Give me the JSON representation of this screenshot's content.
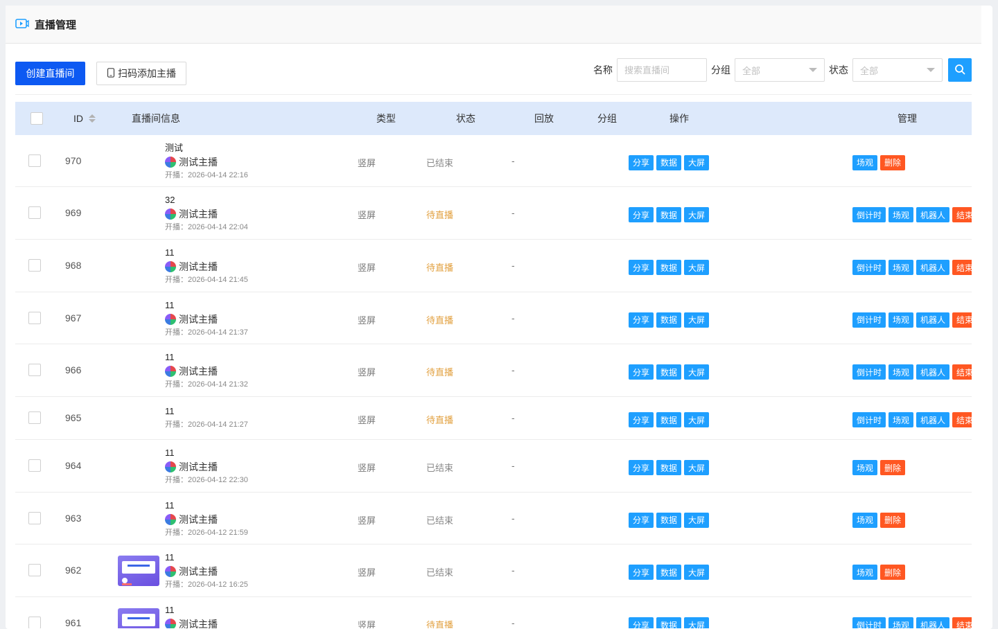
{
  "page": {
    "title": "直播管理"
  },
  "toolbar": {
    "create_label": "创建直播间",
    "scan_label": "扫码添加主播"
  },
  "filters": {
    "name_label": "名称",
    "name_placeholder": "搜索直播间",
    "group_label": "分组",
    "group_value": "全部",
    "status_label": "状态",
    "status_value": "全部"
  },
  "table": {
    "headers": {
      "id": "ID",
      "info": "直播间信息",
      "type": "类型",
      "status": "状态",
      "replay": "回放",
      "group": "分组",
      "ops": "操作",
      "manage": "管理"
    },
    "rows": [
      {
        "id": "970",
        "name": "测试",
        "anchor": "测试主播",
        "time": "开播：2026-04-14 22:16",
        "type": "竖屏",
        "status": "已结束",
        "replay": "-",
        "ops": [
          "分享",
          "数据",
          "大屏"
        ],
        "manage": [
          "场观",
          "删除"
        ]
      },
      {
        "id": "969",
        "name": "32",
        "anchor": "测试主播",
        "time": "开播：2026-04-14 22:04",
        "type": "竖屏",
        "status": "待直播",
        "replay": "-",
        "ops": [
          "分享",
          "数据",
          "大屏"
        ],
        "manage": [
          "倒计时",
          "场观",
          "机器人",
          "结束"
        ]
      },
      {
        "id": "968",
        "name": "11",
        "anchor": "测试主播",
        "time": "开播：2026-04-14 21:45",
        "type": "竖屏",
        "status": "待直播",
        "replay": "-",
        "ops": [
          "分享",
          "数据",
          "大屏"
        ],
        "manage": [
          "倒计时",
          "场观",
          "机器人",
          "结束"
        ]
      },
      {
        "id": "967",
        "name": "11",
        "anchor": "测试主播",
        "time": "开播：2026-04-14 21:37",
        "type": "竖屏",
        "status": "待直播",
        "replay": "-",
        "ops": [
          "分享",
          "数据",
          "大屏"
        ],
        "manage": [
          "倒计时",
          "场观",
          "机器人",
          "结束"
        ]
      },
      {
        "id": "966",
        "name": "11",
        "anchor": "测试主播",
        "time": "开播：2026-04-14 21:32",
        "type": "竖屏",
        "status": "待直播",
        "replay": "-",
        "ops": [
          "分享",
          "数据",
          "大屏"
        ],
        "manage": [
          "倒计时",
          "场观",
          "机器人",
          "结束"
        ]
      },
      {
        "id": "965",
        "name": "11",
        "anchor": "",
        "time": "开播：2026-04-14 21:27",
        "type": "竖屏",
        "status": "待直播",
        "replay": "-",
        "ops": [
          "分享",
          "数据",
          "大屏"
        ],
        "manage": [
          "倒计时",
          "场观",
          "机器人",
          "结束"
        ]
      },
      {
        "id": "964",
        "name": "11",
        "anchor": "测试主播",
        "time": "开播：2026-04-12 22:30",
        "type": "竖屏",
        "status": "已结束",
        "replay": "-",
        "ops": [
          "分享",
          "数据",
          "大屏"
        ],
        "manage": [
          "场观",
          "删除"
        ]
      },
      {
        "id": "963",
        "name": "11",
        "anchor": "测试主播",
        "time": "开播：2026-04-12 21:59",
        "type": "竖屏",
        "status": "已结束",
        "replay": "-",
        "ops": [
          "分享",
          "数据",
          "大屏"
        ],
        "manage": [
          "场观",
          "删除"
        ]
      },
      {
        "id": "962",
        "name": "11",
        "anchor": "测试主播",
        "time": "开播：2026-04-12 16:25",
        "type": "竖屏",
        "status": "已结束",
        "replay": "-",
        "ops": [
          "分享",
          "数据",
          "大屏"
        ],
        "manage": [
          "场观",
          "删除"
        ],
        "thumb": true
      },
      {
        "id": "961",
        "name": "11",
        "anchor": "测试主播",
        "time": "",
        "type": "竖屏",
        "status": "待直播",
        "replay": "-",
        "ops": [
          "分享",
          "数据",
          "大屏"
        ],
        "manage": [
          "倒计时",
          "场观",
          "机器人",
          "结束"
        ],
        "thumb": true
      }
    ]
  },
  "colors": {
    "primary": "#0d59f2",
    "accent": "#1e9fff",
    "danger": "#ff5722",
    "pending": "#e2a03f",
    "header_bg": "#dde9fb"
  }
}
